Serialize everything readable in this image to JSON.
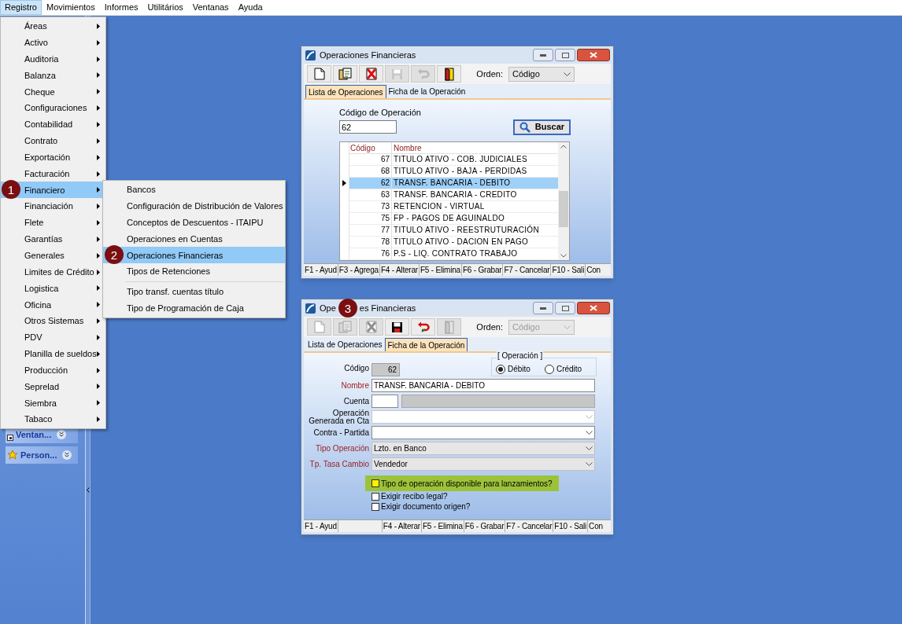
{
  "menu_bar": [
    {
      "label": "Registro",
      "selected": true
    },
    {
      "label": "Movimientos",
      "selected": false
    },
    {
      "label": "Informes",
      "selected": false
    },
    {
      "label": "Utilitários",
      "selected": false
    },
    {
      "label": "Ventanas",
      "selected": false
    },
    {
      "label": "Ayuda",
      "selected": false
    }
  ],
  "registro_menu": [
    {
      "label": "Áreas",
      "selected": false
    },
    {
      "label": "Activo",
      "selected": false
    },
    {
      "label": "Auditoria",
      "selected": false
    },
    {
      "label": "Balanza",
      "selected": false
    },
    {
      "label": "Cheque",
      "selected": false
    },
    {
      "label": "Configuraciones",
      "selected": false
    },
    {
      "label": "Contabilidad",
      "selected": false
    },
    {
      "label": "Contrato",
      "selected": false
    },
    {
      "label": "Exportación",
      "selected": false
    },
    {
      "label": "Facturación",
      "selected": false
    },
    {
      "label": "Financiero",
      "selected": true,
      "callout": "1"
    },
    {
      "label": "Financiación",
      "selected": false
    },
    {
      "label": "Flete",
      "selected": false
    },
    {
      "label": "Garantías",
      "selected": false
    },
    {
      "label": "Generales",
      "selected": false
    },
    {
      "label": "Limites de Crédito",
      "selected": false
    },
    {
      "label": "Logistica",
      "selected": false
    },
    {
      "label": "Oficina",
      "selected": false
    },
    {
      "label": "Otros Sistemas",
      "selected": false
    },
    {
      "label": "PDV",
      "selected": false
    },
    {
      "label": "Planilla de sueldos",
      "selected": false
    },
    {
      "label": "Producción",
      "selected": false
    },
    {
      "label": "Seprelad",
      "selected": false
    },
    {
      "label": "Siembra",
      "selected": false
    },
    {
      "label": "Tabaco",
      "selected": false
    }
  ],
  "financiero_submenu": [
    {
      "label": "Bancos",
      "selected": false,
      "separator_before": false
    },
    {
      "label": "Configuración de Distribución de Valores",
      "selected": false,
      "separator_before": false
    },
    {
      "label": "Conceptos de Descuentos - ITAIPU",
      "selected": false,
      "separator_before": false
    },
    {
      "label": "Operaciones en Cuentas",
      "selected": false,
      "separator_before": false
    },
    {
      "label": "Operaciones Financieras",
      "selected": true,
      "separator_before": false,
      "callout": "2"
    },
    {
      "label": "Tipos de Retenciones",
      "selected": false,
      "separator_before": false
    },
    {
      "label": "Tipo transf. cuentas título",
      "selected": false,
      "separator_before": true
    },
    {
      "label": "Tipo de Programación de Caja",
      "selected": false,
      "separator_before": false
    }
  ],
  "sidebar": {
    "panels": [
      {
        "label": "Ventan...",
        "kind": "window"
      },
      {
        "label": "Person...",
        "kind": "star"
      }
    ]
  },
  "list_window": {
    "title": "Operaciones Financieras",
    "toolbar": [
      {
        "kind": "new",
        "disabled": false
      },
      {
        "kind": "copy",
        "disabled": false
      },
      {
        "kind": "delete",
        "disabled": false
      },
      {
        "kind": "save",
        "disabled": true
      },
      {
        "kind": "undo",
        "disabled": true
      },
      {
        "kind": "exit",
        "disabled": false
      }
    ],
    "order": {
      "label": "Orden:",
      "value": "Código",
      "disabled": false
    },
    "tabs": [
      {
        "label": "Lista de Operaciones",
        "selected": true
      },
      {
        "label": "Ficha de la Operación",
        "selected": false
      }
    ],
    "search": {
      "label": "Código de Operación",
      "value": "62",
      "button": "Buscar"
    },
    "grid": {
      "columns": [
        "Código",
        "Nombre"
      ],
      "rows": [
        {
          "code": "67",
          "name": "TITULO ATIVO - COB. JUDICIALES",
          "selected": false
        },
        {
          "code": "68",
          "name": "TITULO ATIVO - BAJA - PERDIDAS",
          "selected": false
        },
        {
          "code": "62",
          "name": "TRANSF. BANCARIA - DEBITO",
          "selected": true
        },
        {
          "code": "63",
          "name": "TRANSF. BANCARIA - CREDITO",
          "selected": false
        },
        {
          "code": "73",
          "name": "RETENCION - VIRTUAL",
          "selected": false
        },
        {
          "code": "75",
          "name": "FP - PAGOS DE AGUINALDO",
          "selected": false
        },
        {
          "code": "77",
          "name": "TITULO ATIVO - REESTRUTURACIÓN",
          "selected": false
        },
        {
          "code": "78",
          "name": "TITULO ATIVO - DACION EN PAGO",
          "selected": false
        },
        {
          "code": "76",
          "name": "P.S - LIQ. CONTRATO TRABAJO",
          "selected": false
        }
      ]
    },
    "function_keys": [
      {
        "kind": "key",
        "label": "F1 - Ayud"
      },
      {
        "kind": "key",
        "label": "F3 - Agrega"
      },
      {
        "kind": "key",
        "label": "F4 - Alterar"
      },
      {
        "kind": "key",
        "label": "F5 - Elimina"
      },
      {
        "kind": "key",
        "label": "F6 - Grabar"
      },
      {
        "kind": "key",
        "label": "F7 - Cancelar"
      },
      {
        "kind": "key",
        "label": "F10 - Sali"
      },
      {
        "kind": "key",
        "label": "Con"
      }
    ]
  },
  "detail_window": {
    "title_fragments": [
      "Ope",
      "es Financieras"
    ],
    "callout": "3",
    "toolbar": [
      {
        "kind": "new",
        "disabled": true
      },
      {
        "kind": "copy",
        "disabled": true
      },
      {
        "kind": "delete",
        "disabled": true
      },
      {
        "kind": "save",
        "disabled": false
      },
      {
        "kind": "undo",
        "disabled": false
      },
      {
        "kind": "exit",
        "disabled": true
      }
    ],
    "order": {
      "label": "Orden:",
      "value": "Código",
      "disabled": true
    },
    "tabs": [
      {
        "label": "Lista de Operaciones",
        "selected": false
      },
      {
        "label": "Ficha de la Operación",
        "selected": true
      }
    ],
    "codigo": {
      "label": "Código",
      "value": "62"
    },
    "operation_group": {
      "title": "[ Operación ]",
      "options": [
        {
          "label": "Débito",
          "selected": true
        },
        {
          "label": "Crédito",
          "selected": false
        }
      ]
    },
    "fields": [
      {
        "kind": "text",
        "label": "Nombre",
        "required": true,
        "value": "TRANSF. BANCARIA - DEBITO"
      },
      {
        "kind": "account",
        "label": "Cuenta",
        "required": false
      },
      {
        "kind": "select",
        "label": "Operación Generada en Cta",
        "required": false,
        "disabled": true
      },
      {
        "kind": "select",
        "label": "Contra - Partida",
        "required": false,
        "disabled": false
      },
      {
        "kind": "select",
        "label": "Tipo Operación",
        "required": true,
        "disabled": false,
        "value": "Lzto. en Banco"
      },
      {
        "kind": "select",
        "label": "Tp. Tasa Cambio",
        "required": true,
        "disabled": false,
        "value": "Vendedor"
      }
    ],
    "checkboxes": [
      {
        "label": "Tipo de operación disponible para lanzamientos?",
        "checked": false,
        "highlighted": true
      },
      {
        "label": "Exigir recibo legal?",
        "checked": false,
        "highlighted": false
      },
      {
        "label": "Exigir documento origen?",
        "checked": false,
        "highlighted": false
      }
    ],
    "function_keys": [
      {
        "kind": "key",
        "label": "F1 - Ayud"
      },
      {
        "kind": "empty"
      },
      {
        "kind": "key",
        "label": "F4 - Alterar"
      },
      {
        "kind": "key",
        "label": "F5 - Elimina"
      },
      {
        "kind": "key",
        "label": "F6 - Grabar"
      },
      {
        "kind": "key",
        "label": "F7 - Cancelar"
      },
      {
        "kind": "key",
        "label": "F10 - Sali"
      },
      {
        "kind": "key",
        "label": "Con"
      }
    ]
  }
}
